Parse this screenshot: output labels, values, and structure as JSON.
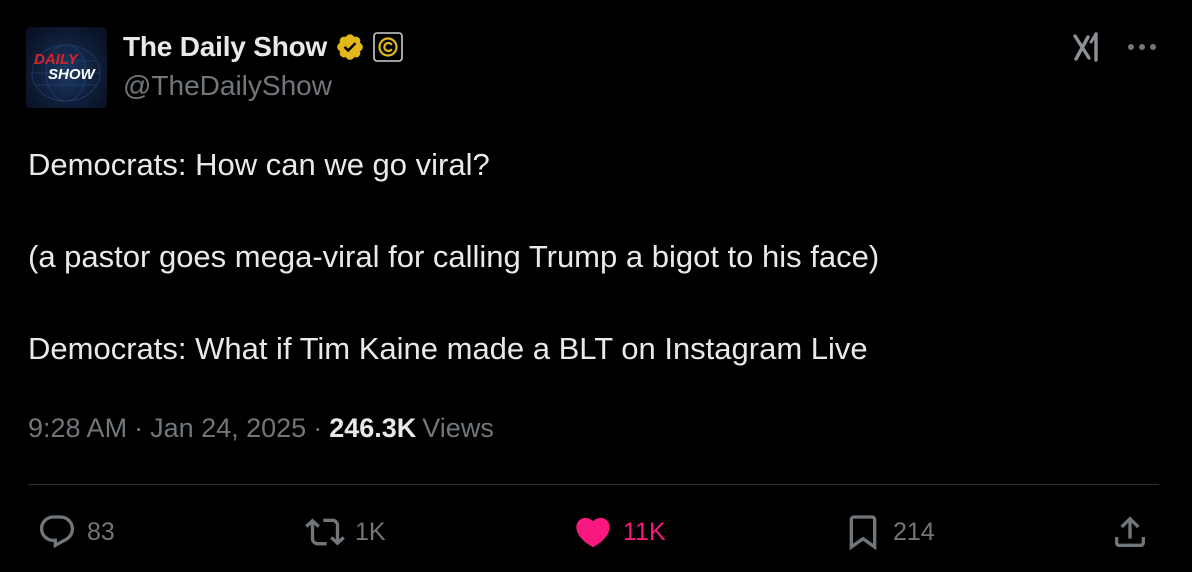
{
  "tweet": {
    "avatar_text_top": "DAILY",
    "avatar_text_bottom": "SHOW",
    "display_name": "The Daily Show",
    "handle": "@TheDailyShow",
    "body_lines": [
      "Democrats: How can we go viral?",
      "(a pastor goes mega-viral for calling Trump a bigot to his face)",
      "Democrats: What if Tim Kaine made a BLT on Instagram Live"
    ],
    "time": "9:28 AM",
    "separator": "·",
    "date": "Jan 24, 2025",
    "views_count": "246.3K",
    "views_label": "Views"
  },
  "actions": {
    "replies": "83",
    "reposts": "1K",
    "likes": "11K",
    "bookmarks": "214"
  },
  "icons": {
    "verified": "verified-badge-icon",
    "affiliate": "comedy-central-affiliate-icon",
    "grok": "grok-icon",
    "more": "more-icon",
    "reply": "reply-icon",
    "repost": "repost-icon",
    "like": "heart-icon",
    "bookmark": "bookmark-icon",
    "share": "share-icon"
  },
  "colors": {
    "background": "#000000",
    "text_primary": "#e7e9ea",
    "text_secondary": "#71767b",
    "divider": "#2f3336",
    "like_active": "#f91880",
    "verified_gold": "#e2b719",
    "avatar_red": "#d8232a"
  }
}
